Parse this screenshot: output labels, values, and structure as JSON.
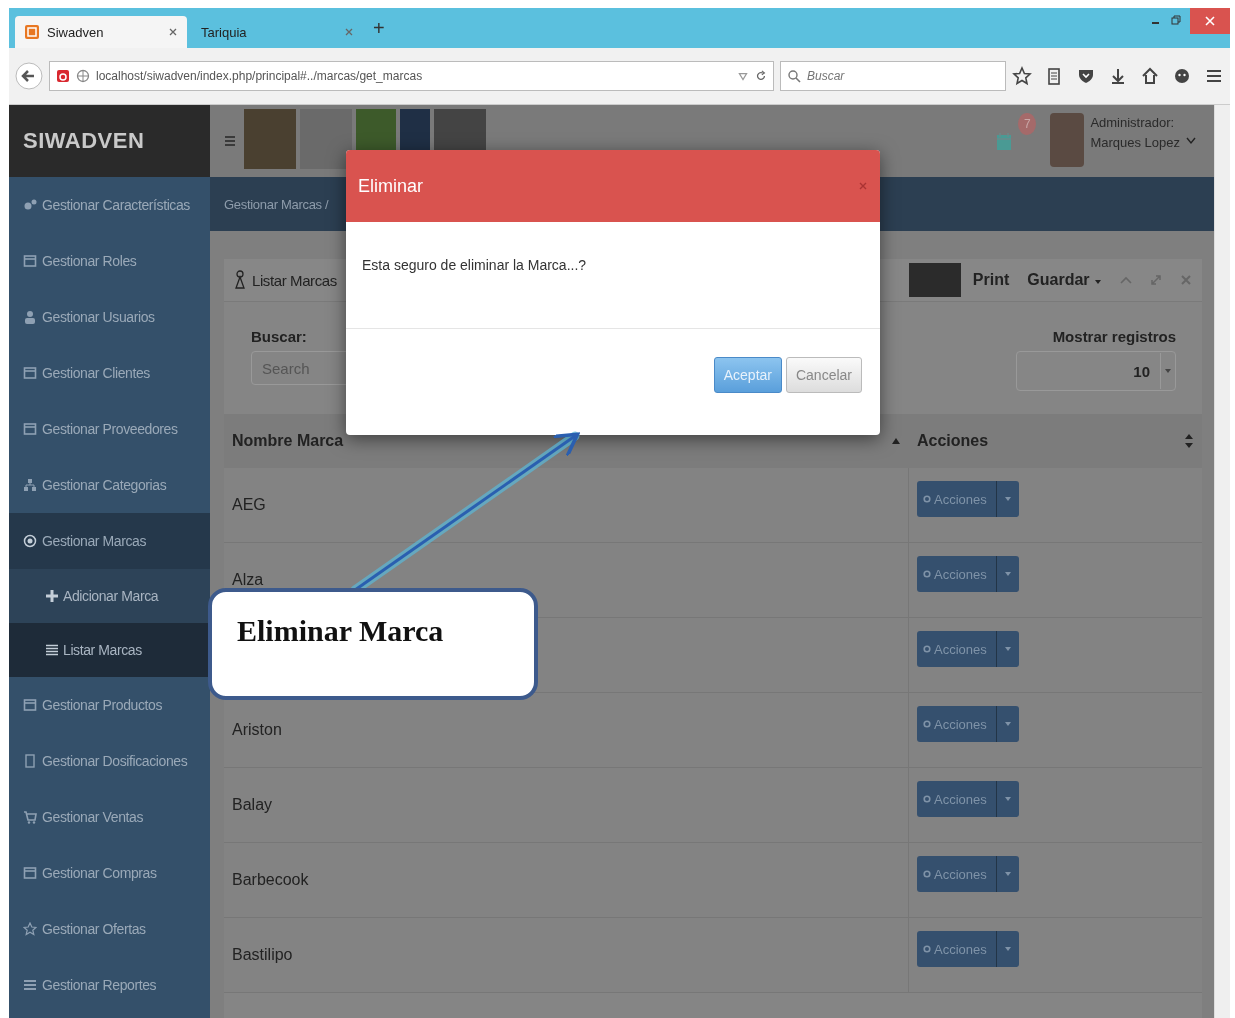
{
  "browser": {
    "tabs": [
      {
        "label": "Siwadven",
        "selected": true
      },
      {
        "label": "Tariquia",
        "selected": false
      }
    ],
    "new_tab": "+",
    "url": "localhost/siwadven/index.php/principal#../marcas/get_marcas",
    "search_placeholder": "Buscar"
  },
  "app": {
    "logo": "SIWADVEN",
    "notification_count": "7",
    "user": {
      "role": "Administrador:",
      "name": "Marques Lopez"
    },
    "breadcrumb": "Gestionar Marcas /",
    "sidebar": {
      "items": [
        {
          "label": "Gestionar Características",
          "selected": false
        },
        {
          "label": "Gestionar Roles",
          "selected": false
        },
        {
          "label": "Gestionar Usuarios",
          "selected": false
        },
        {
          "label": "Gestionar Clientes",
          "selected": false
        },
        {
          "label": "Gestionar Proveedores",
          "selected": false
        },
        {
          "label": "Gestionar Categorias",
          "selected": false
        },
        {
          "label": "Gestionar Marcas",
          "selected": true,
          "expanded": true,
          "children": [
            {
              "label": "Adicionar Marca",
              "selected": false
            },
            {
              "label": "Listar Marcas",
              "selected": true
            }
          ]
        },
        {
          "label": "Gestionar Productos",
          "selected": false
        },
        {
          "label": "Gestionar Dosificaciones",
          "selected": false
        },
        {
          "label": "Gestionar Ventas",
          "selected": false
        },
        {
          "label": "Gestionar Compras",
          "selected": false
        },
        {
          "label": "Gestionar Ofertas",
          "selected": false
        },
        {
          "label": "Gestionar Reportes",
          "selected": false
        }
      ]
    },
    "panel": {
      "title": "Listar Marcas",
      "tools": [
        "Print",
        "Guardar"
      ],
      "search_label": "Buscar:",
      "search_placeholder": "Search",
      "page_size_label": "Mostrar registros",
      "page_size": "10",
      "columns": [
        "Nombre Marca",
        "Acciones"
      ],
      "rows": [
        {
          "name": "AEG",
          "action": "Acciones"
        },
        {
          "name": "Alza",
          "action": "Acciones"
        },
        {
          "action": "Acciones"
        },
        {
          "name": "Ariston",
          "action": "Acciones"
        },
        {
          "name": "Balay",
          "action": "Acciones"
        },
        {
          "name": "Barbecook",
          "action": "Acciones"
        },
        {
          "name": "Bastilipo",
          "action": "Acciones"
        }
      ]
    }
  },
  "modal": {
    "title": "Eliminar",
    "message": "Esta seguro de eliminar la Marca...?",
    "buttons": [
      {
        "label": "Aceptar",
        "kind": "primary"
      },
      {
        "label": "Cancelar",
        "kind": "default"
      }
    ]
  },
  "callout": {
    "text": "Eliminar Marca"
  }
}
